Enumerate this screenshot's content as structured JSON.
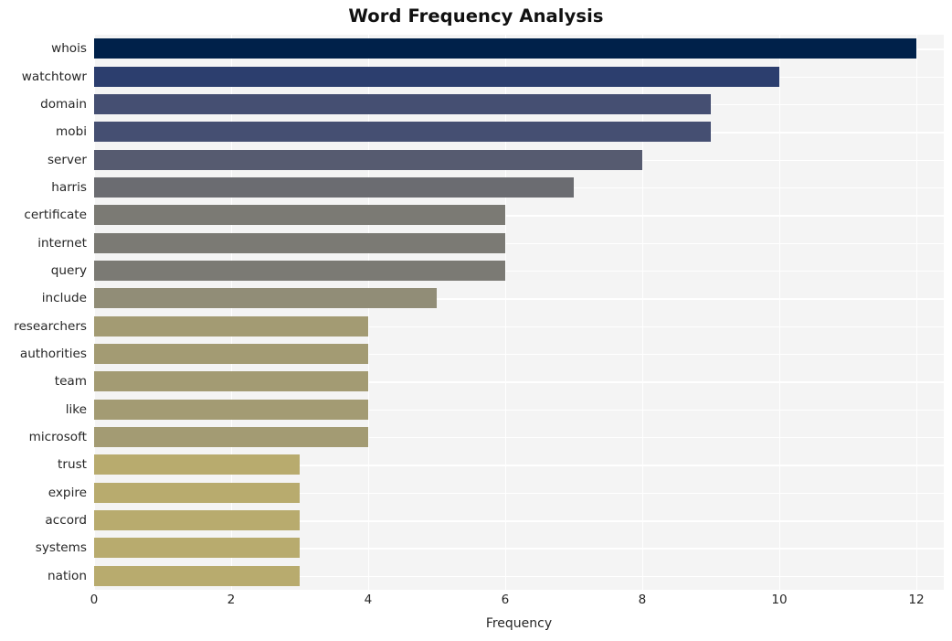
{
  "chart_data": {
    "type": "bar",
    "orientation": "horizontal",
    "title": "Word Frequency Analysis",
    "xlabel": "Frequency",
    "ylabel": "",
    "xlim": [
      0,
      12.4
    ],
    "xticks": [
      0,
      2,
      4,
      6,
      8,
      10,
      12
    ],
    "xtick_labels": [
      "0",
      "2",
      "4",
      "6",
      "8",
      "10",
      "12"
    ],
    "grid": true,
    "legend": null,
    "categories": [
      "whois",
      "watchtowr",
      "domain",
      "mobi",
      "server",
      "harris",
      "certificate",
      "internet",
      "query",
      "include",
      "researchers",
      "authorities",
      "team",
      "like",
      "microsoft",
      "trust",
      "expire",
      "accord",
      "systems",
      "nation"
    ],
    "values": [
      12,
      10,
      9,
      9,
      8,
      7,
      6,
      6,
      6,
      5,
      4,
      4,
      4,
      4,
      4,
      3,
      3,
      3,
      3,
      3
    ],
    "bar_colors": [
      "#00214a",
      "#2c3e6e",
      "#454f72",
      "#454f72",
      "#565b70",
      "#6b6c71",
      "#7b7a74",
      "#7b7a74",
      "#7b7a74",
      "#918d77",
      "#a39b73",
      "#a39b73",
      "#a39b73",
      "#a39b73",
      "#a39b73",
      "#b8ab6e",
      "#b8ab6e",
      "#b8ab6e",
      "#b8ab6e",
      "#b8ab6e"
    ],
    "colormap": "cividis",
    "style": {
      "figure_background": "#ffffff",
      "axes_background": "#f4f4f4",
      "grid_color": "#ffffff",
      "tick_label_color": "#262626",
      "title_color": "#111111"
    }
  }
}
